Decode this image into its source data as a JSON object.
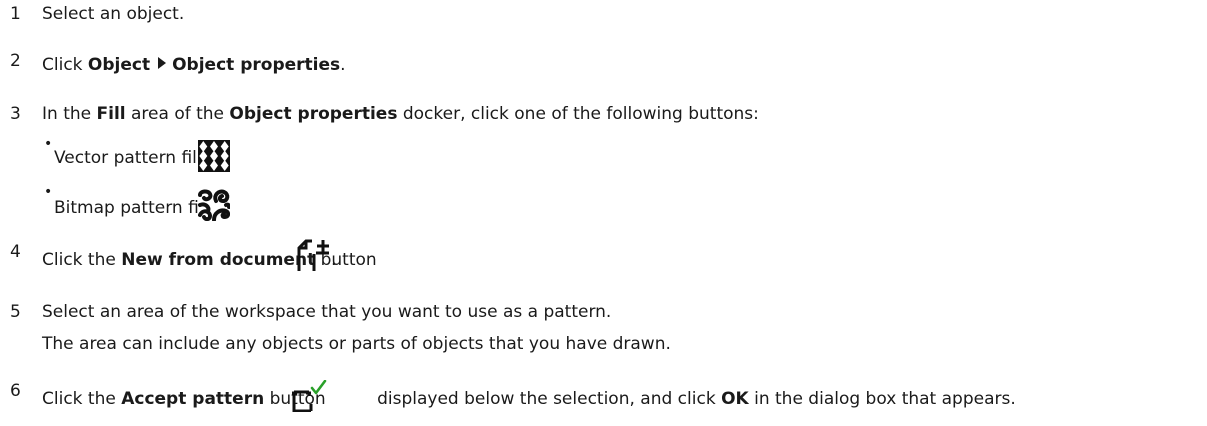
{
  "steps": [
    {
      "num": "1",
      "text": "Select an object."
    },
    {
      "num": "2",
      "pre": "Click ",
      "menu1": "Object",
      "menu2": "Object properties",
      "post": "."
    },
    {
      "num": "3",
      "pre": "In the ",
      "b1": "Fill",
      "mid1": " area of the ",
      "b2": "Object properties",
      "post": " docker, click one of the following buttons:"
    },
    {
      "num": "4",
      "pre": "Click the ",
      "b1": "New from document",
      "post": " button",
      "end": "."
    },
    {
      "num": "5",
      "line1": "Select an area of the workspace that you want to use as a pattern.",
      "line2": "The area can include any objects or parts of objects that you have drawn."
    },
    {
      "num": "6",
      "pre": "Click the ",
      "b1": "Accept pattern",
      "mid": " button",
      "post": " displayed below the selection, and click ",
      "b2": "OK",
      "end": " in the dialog box that appears."
    }
  ],
  "bullets": [
    {
      "label": "Vector pattern fill",
      "icon": "vector-pattern-icon"
    },
    {
      "label": "Bitmap pattern fill",
      "icon": "bitmap-pattern-icon"
    }
  ],
  "bullet_char": "•"
}
